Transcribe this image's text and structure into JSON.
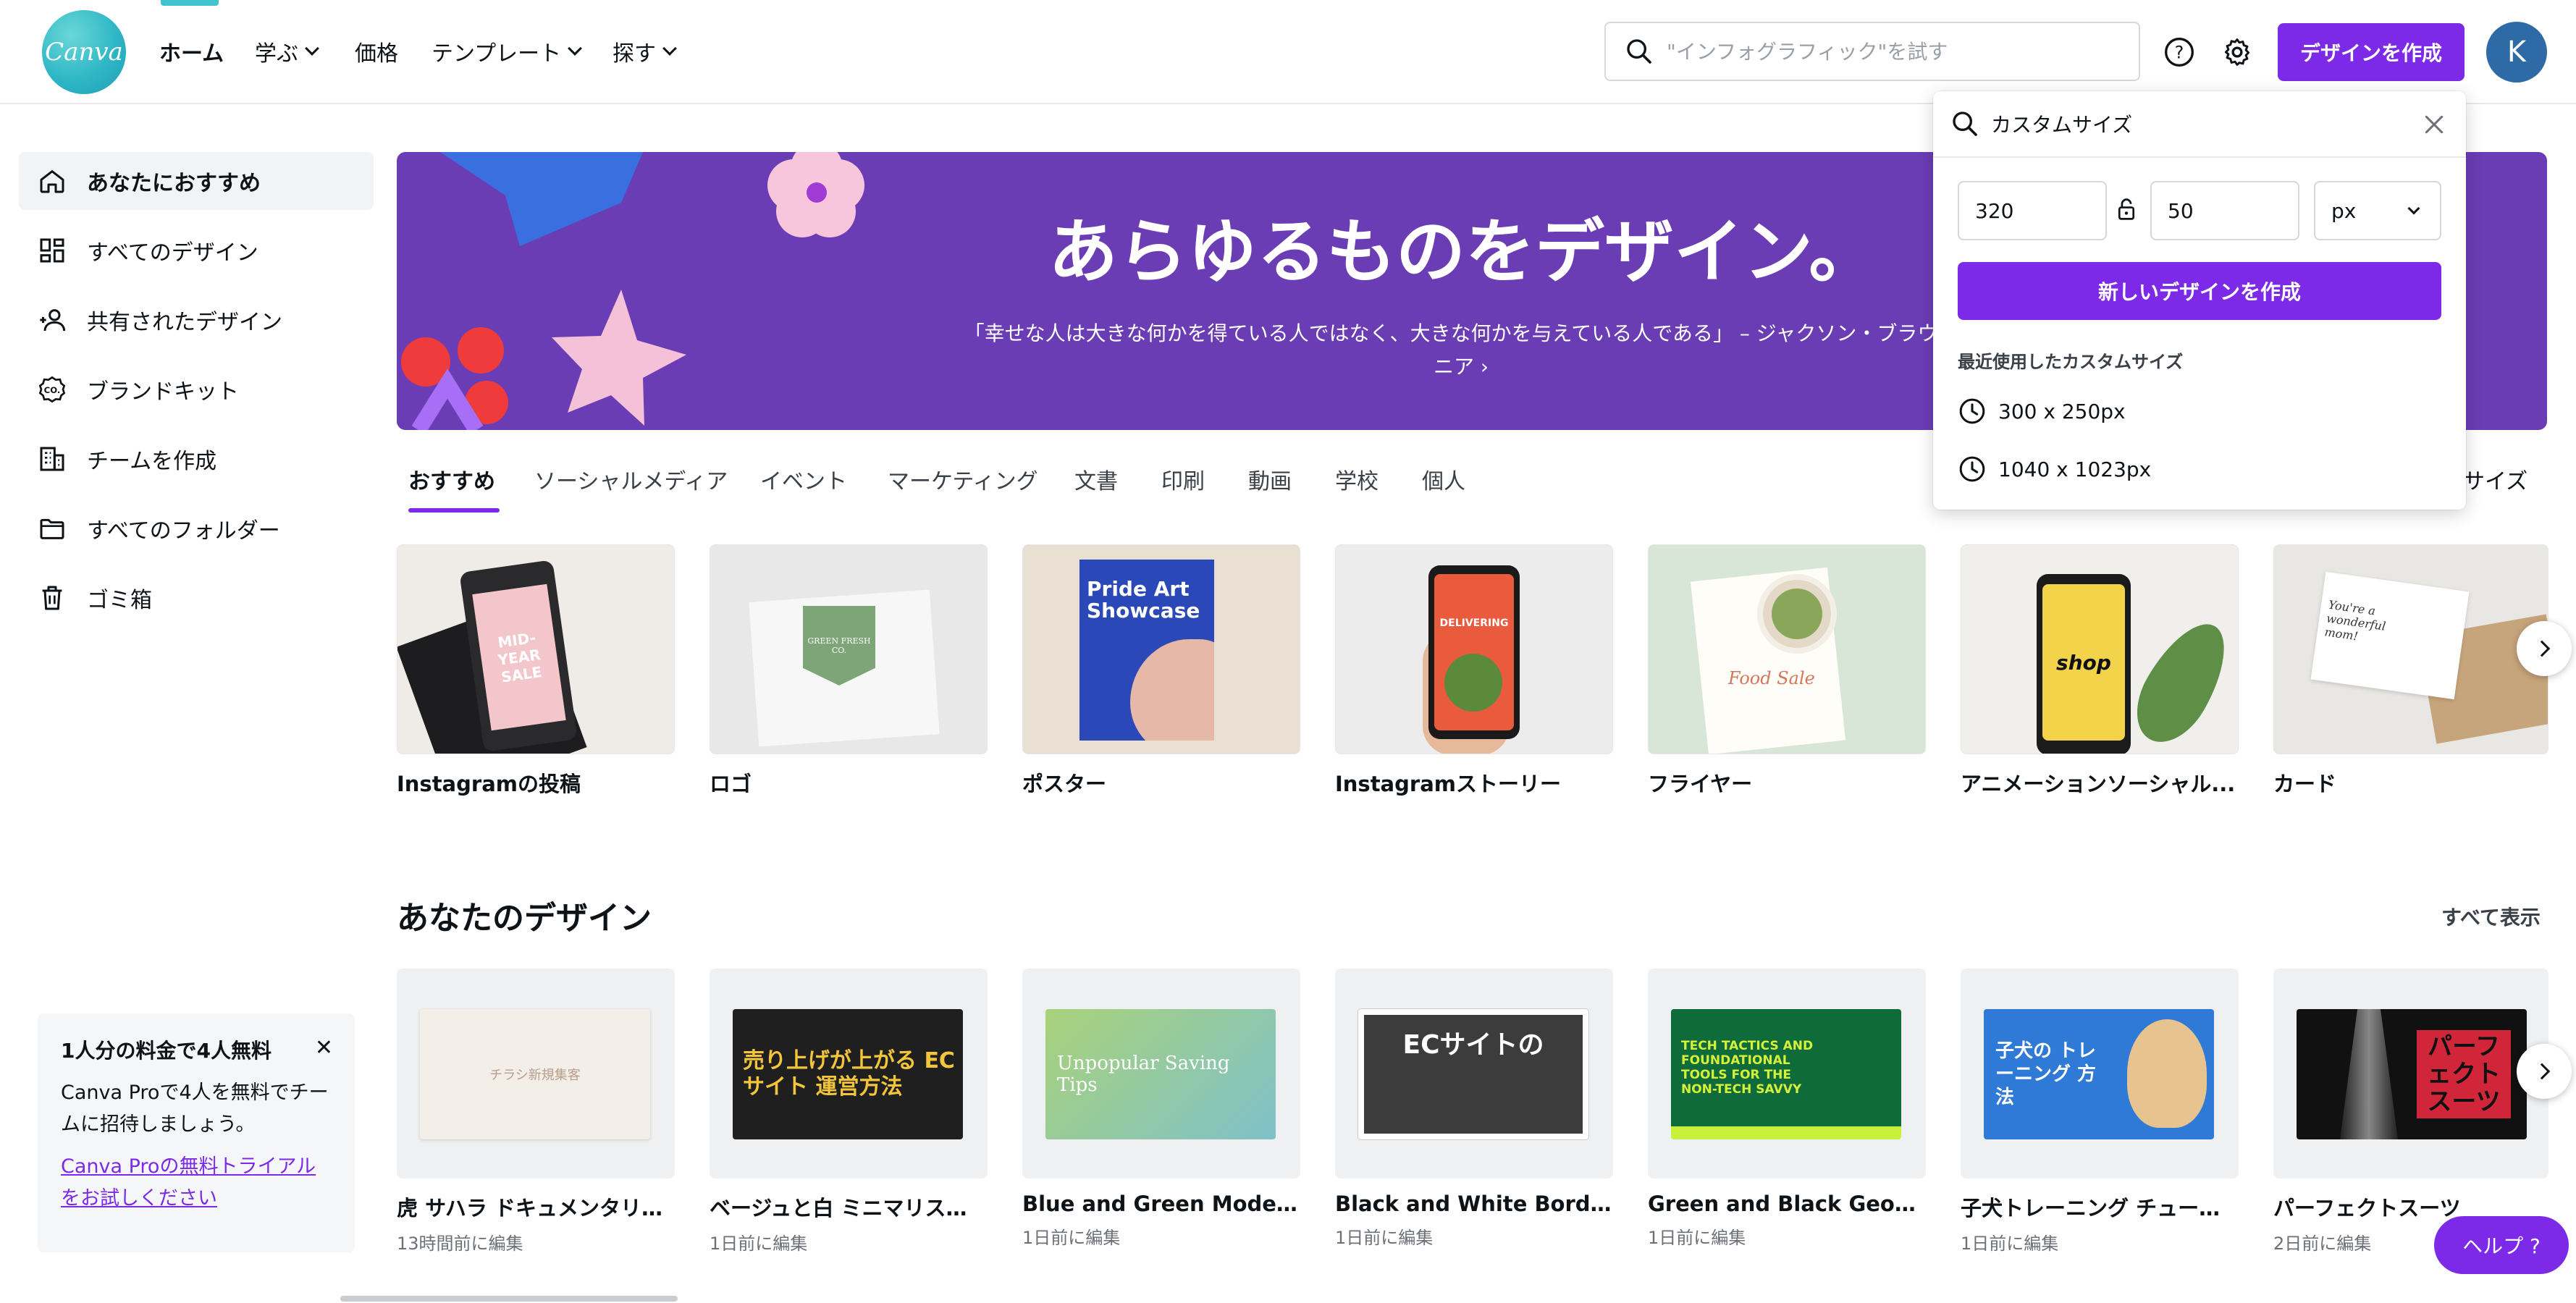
{
  "app": {
    "logo_text": "Canva",
    "accent_color": "#7d2ae8",
    "brand_color": "#40c4cf"
  },
  "nav": {
    "home": "ホーム",
    "learn": "学ぶ",
    "pricing": "価格",
    "templates": "テンプレート",
    "explore": "探す"
  },
  "search": {
    "placeholder": "\"インフォグラフィック\"を試す"
  },
  "header": {
    "help_icon": "question-circle-icon",
    "settings_icon": "gear-icon",
    "create_label": "デザインを作成",
    "avatar_initial": "K"
  },
  "sidebar": {
    "items": [
      {
        "label": "あなたにおすすめ",
        "icon": "home-icon",
        "active": true
      },
      {
        "label": "すべてのデザイン",
        "icon": "grid-icon"
      },
      {
        "label": "共有されたデザイン",
        "icon": "people-icon"
      },
      {
        "label": "ブランドキット",
        "icon": "brand-kit-icon"
      },
      {
        "label": "チームを作成",
        "icon": "building-icon"
      },
      {
        "label": "すべてのフォルダー",
        "icon": "folder-icon"
      },
      {
        "label": "ゴミ箱",
        "icon": "trash-icon"
      }
    ],
    "promo": {
      "title": "1人分の料金で4人無料",
      "body": "Canva Proで4人を無料でチームに招待しましょう。",
      "link": "Canva Proの無料トライアルをお試しください"
    }
  },
  "hero": {
    "title": "あらゆるものをデザイン。",
    "quote_line1": "「幸せな人は大きな何かを得ている人ではなく、大きな何かを与えている人である」 – ジャクソン・ブラウン",
    "quote_line2": "ニア ›"
  },
  "tabs": [
    "おすすめ",
    "ソーシャルメディア",
    "イベント",
    "マーケティング",
    "文書",
    "印刷",
    "動画",
    "学校",
    "個人"
  ],
  "tab_custom_size": "ムサイズ",
  "templates": [
    {
      "label": "Instagramの投稿",
      "thumb_text": "MID-YEAR SALE"
    },
    {
      "label": "ロゴ",
      "thumb_text": "GREEN FRESH CO."
    },
    {
      "label": "ポスター",
      "thumb_text": "Pride Art Showcase"
    },
    {
      "label": "Instagramストーリー",
      "thumb_text": "DELIVERING"
    },
    {
      "label": "フライヤー",
      "thumb_text": "Food Sale"
    },
    {
      "label": "アニメーションソーシャル...",
      "thumb_text": "shop"
    },
    {
      "label": "カード",
      "thumb_text": "You're a wonderful mom!"
    }
  ],
  "designs_section": {
    "title": "あなたのデザイン",
    "see_all": "すべて表示"
  },
  "designs": [
    {
      "title": "虎 サハラ ドキュメンタリー ...",
      "edited": "13時間前に編集",
      "thumb_text": "チラシ新規集客"
    },
    {
      "title": "ベージュと白 ミニマリスト ...",
      "edited": "1日前に編集",
      "thumb_text": "売り上げが上がる ECサイト 運営方法"
    },
    {
      "title": "Blue and Green Modern G...",
      "edited": "1日前に編集",
      "thumb_text": "Unpopular Saving Tips"
    },
    {
      "title": "Black and White Bordered ...",
      "edited": "1日前に編集",
      "thumb_text": "ECサイトの"
    },
    {
      "title": "Green and Black Geometri...",
      "edited": "1日前に編集",
      "thumb_text": "TECH TACTICS AND FOUNDATIONAL TOOLS FOR THE NON-TECH SAVVY"
    },
    {
      "title": "子犬トレーニング チュート...",
      "edited": "1日前に編集",
      "thumb_text": "子犬の トレーニング 方法"
    },
    {
      "title": "パーフェクトスーツ",
      "edited": "2日前に編集",
      "thumb_text": "パーフェクト スーツ"
    }
  ],
  "custom_size": {
    "search_value": "カスタムサイズ",
    "width": "320",
    "height": "50",
    "unit": "px",
    "create_label": "新しいデザインを作成",
    "recent_label": "最近使用したカスタムサイズ",
    "recent": [
      "300 x 250px",
      "1040 x 1023px"
    ]
  },
  "help": {
    "label": "ヘルプ ?"
  }
}
